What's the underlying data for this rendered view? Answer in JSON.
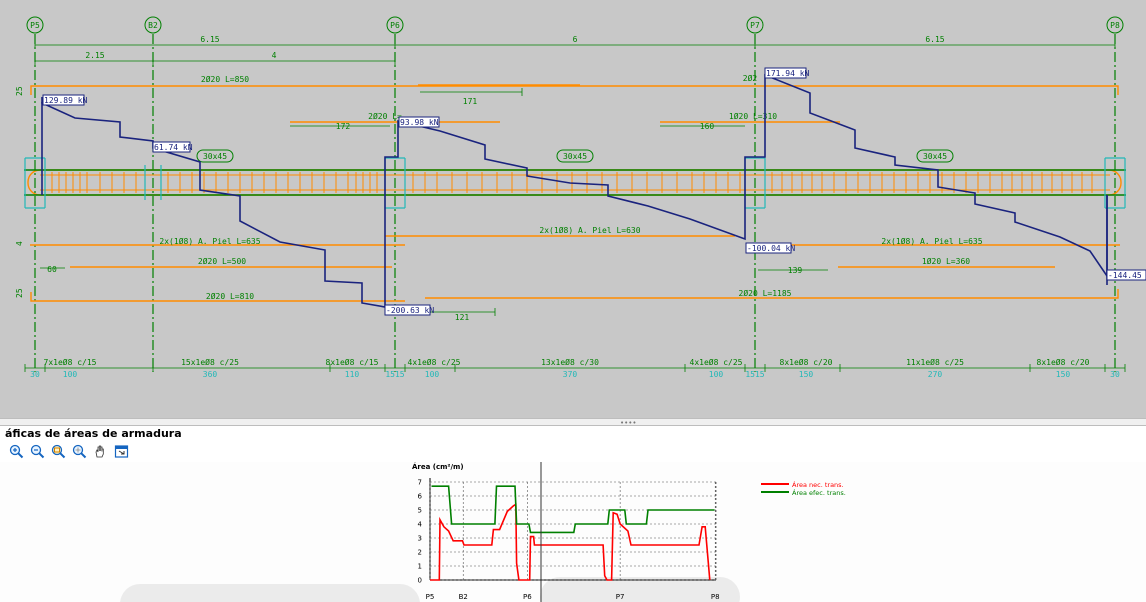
{
  "columns": [
    "P5",
    "B2",
    "P6",
    "P7",
    "P8"
  ],
  "dims_top": {
    "spans": [
      "2.15",
      "6.15",
      "4",
      "6",
      "6.15"
    ]
  },
  "section_labels": [
    "30x45",
    "30x45",
    "30x45"
  ],
  "rebar_labels": {
    "top_long": "2Ø20 L=850",
    "top_mid": "2Ø20 L=",
    "top_right_a": "2Ø2",
    "top_right_b": "1Ø20 L=310",
    "skin_left": "2x(1Ø8) A. Piel L=635",
    "skin_mid": "2x(1Ø8) A. Piel L=630",
    "skin_right": "2x(1Ø8) A. Piel L=635",
    "bot_left": "2Ø20 L=500",
    "bot_right": "1Ø20 L=360",
    "bot_long_left": "2Ø20 L=810",
    "bot_long_right": "2Ø20 L=1185"
  },
  "anchor_lengths": [
    "171",
    "172",
    "160",
    "60",
    "139",
    "121"
  ],
  "shear_labels": [
    "129.89 kN",
    "61.74 kN",
    "93.98 kN",
    "-200.63 kN",
    "171.94 kN",
    "-100.04 kN",
    "-144.45 k"
  ],
  "side_marks": [
    "25",
    "4",
    "25"
  ],
  "stirrups": [
    "7x1eØ8 c/15",
    "15x1eØ8 c/25",
    "8x1eØ8 c/15",
    "4x1eØ8 c/25",
    "13x1eØ8 c/30",
    "4x1eØ8 c/25",
    "8x1eØ8 c/20",
    "11x1eØ8 c/25",
    "8x1eØ8 c/20"
  ],
  "stirrup_lengths": [
    "30",
    "100",
    "360",
    "110",
    "1515",
    "100",
    "370",
    "100",
    "1515",
    "150",
    "270",
    "150",
    "30"
  ],
  "panel": {
    "title": "áficas de áreas de armadura",
    "toolbar_icons": [
      "zoom-in-icon",
      "zoom-out-icon",
      "zoom-window-icon",
      "zoom-extents-icon",
      "pan-icon",
      "print-icon"
    ]
  },
  "area_chart": {
    "ylabel": "Área (cm²/m)",
    "yticks": [
      "7",
      "6",
      "5",
      "4",
      "3",
      "2",
      "1",
      "0"
    ],
    "xticks": [
      "P5",
      "B2",
      "P6",
      "P7",
      "P8"
    ],
    "legend": [
      {
        "name": "Área nec. trans.",
        "color": "#ff0000"
      },
      {
        "name": "Área efec. trans.",
        "color": "#008000"
      }
    ]
  },
  "chart_data": {
    "type": "line",
    "ylabel": "Área (cm²/m)",
    "ylim": [
      0,
      7
    ],
    "xlim": [
      0,
      18.5
    ],
    "x_ticks": [
      {
        "label": "P5",
        "x": 0
      },
      {
        "label": "B2",
        "x": 2.15
      },
      {
        "label": "P6",
        "x": 6.3
      },
      {
        "label": "P7",
        "x": 12.3
      },
      {
        "label": "P8",
        "x": 18.45
      }
    ],
    "series": [
      {
        "name": "Área nec. trans.",
        "color": "#ff0000",
        "points": [
          [
            0,
            0
          ],
          [
            0.6,
            0
          ],
          [
            0.65,
            4.3
          ],
          [
            0.9,
            3.8
          ],
          [
            1.2,
            3.5
          ],
          [
            1.5,
            2.8
          ],
          [
            2.1,
            2.8
          ],
          [
            2.2,
            2.5
          ],
          [
            4.0,
            2.5
          ],
          [
            4.1,
            3.6
          ],
          [
            4.5,
            3.6
          ],
          [
            5.0,
            4.9
          ],
          [
            5.4,
            5.3
          ],
          [
            5.55,
            5.4
          ],
          [
            5.6,
            1.2
          ],
          [
            5.75,
            0
          ],
          [
            6.45,
            0
          ],
          [
            6.5,
            3.1
          ],
          [
            6.7,
            3.1
          ],
          [
            6.75,
            2.5
          ],
          [
            11.2,
            2.5
          ],
          [
            11.3,
            0.3
          ],
          [
            11.45,
            0
          ],
          [
            11.75,
            0
          ],
          [
            11.85,
            4.8
          ],
          [
            12.1,
            4.7
          ],
          [
            12.3,
            4.0
          ],
          [
            12.8,
            3.5
          ],
          [
            13.0,
            2.5
          ],
          [
            17.4,
            2.5
          ],
          [
            17.6,
            3.8
          ],
          [
            17.8,
            3.8
          ],
          [
            18.1,
            0
          ]
        ]
      },
      {
        "name": "Área efec. trans.",
        "color": "#008000",
        "points": [
          [
            0.1,
            6.7
          ],
          [
            1.2,
            6.7
          ],
          [
            1.4,
            4.0
          ],
          [
            4.2,
            4.0
          ],
          [
            4.3,
            6.7
          ],
          [
            5.5,
            6.7
          ],
          [
            5.6,
            4.0
          ],
          [
            6.4,
            4.0
          ],
          [
            6.5,
            3.4
          ],
          [
            9.3,
            3.4
          ],
          [
            9.4,
            4.0
          ],
          [
            11.5,
            4.0
          ],
          [
            11.6,
            5.0
          ],
          [
            12.6,
            5.0
          ],
          [
            12.7,
            4.0
          ],
          [
            14.0,
            4.0
          ],
          [
            14.1,
            5.0
          ],
          [
            18.4,
            5.0
          ]
        ]
      }
    ]
  }
}
